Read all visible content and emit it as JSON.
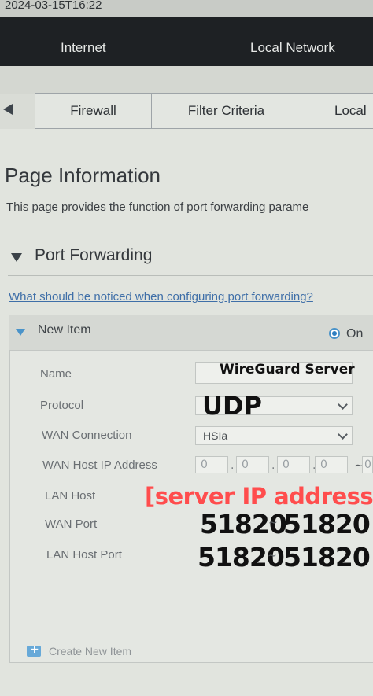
{
  "timestamp": "2024-03-15T16:22",
  "nav": {
    "internet": "Internet",
    "local_network": "Local Network"
  },
  "tabs": {
    "firewall": "Firewall",
    "filter_criteria": "Filter Criteria",
    "local": "Local"
  },
  "page": {
    "title": "Page Information",
    "description": "This page provides the function of port forwarding parame"
  },
  "section": {
    "title": "Port Forwarding",
    "help_link": "What should be noticed when configuring port forwarding?"
  },
  "item": {
    "title": "New Item",
    "toggle_label": "On",
    "toggle_on": true,
    "fields": {
      "name_label": "Name",
      "name_value": "WireGuard Server",
      "protocol_label": "Protocol",
      "protocol_value": "UDP",
      "wan_connection_label": "WAN Connection",
      "wan_connection_value": "HSIa",
      "wan_host_ip_label": "WAN Host IP Address",
      "wan_host_ip_start": [
        "0",
        "0",
        "0",
        "0"
      ],
      "wan_host_ip_end_first": "0",
      "lan_host_label": "LAN Host",
      "lan_host_value": "[server IP address]",
      "wan_port_label": "WAN Port",
      "wan_port_start": "51820",
      "wan_port_end": "51820",
      "lan_host_port_label": "LAN Host Port",
      "lan_host_port_start": "51820",
      "lan_host_port_end": "51820",
      "range_separator": "~",
      "ip_separator": "."
    }
  },
  "create_item_label": "Create New Item",
  "colors": {
    "accent": "#4a93c9",
    "annotation_red": "#ff4d4d",
    "nav_bg": "#1e2124"
  }
}
